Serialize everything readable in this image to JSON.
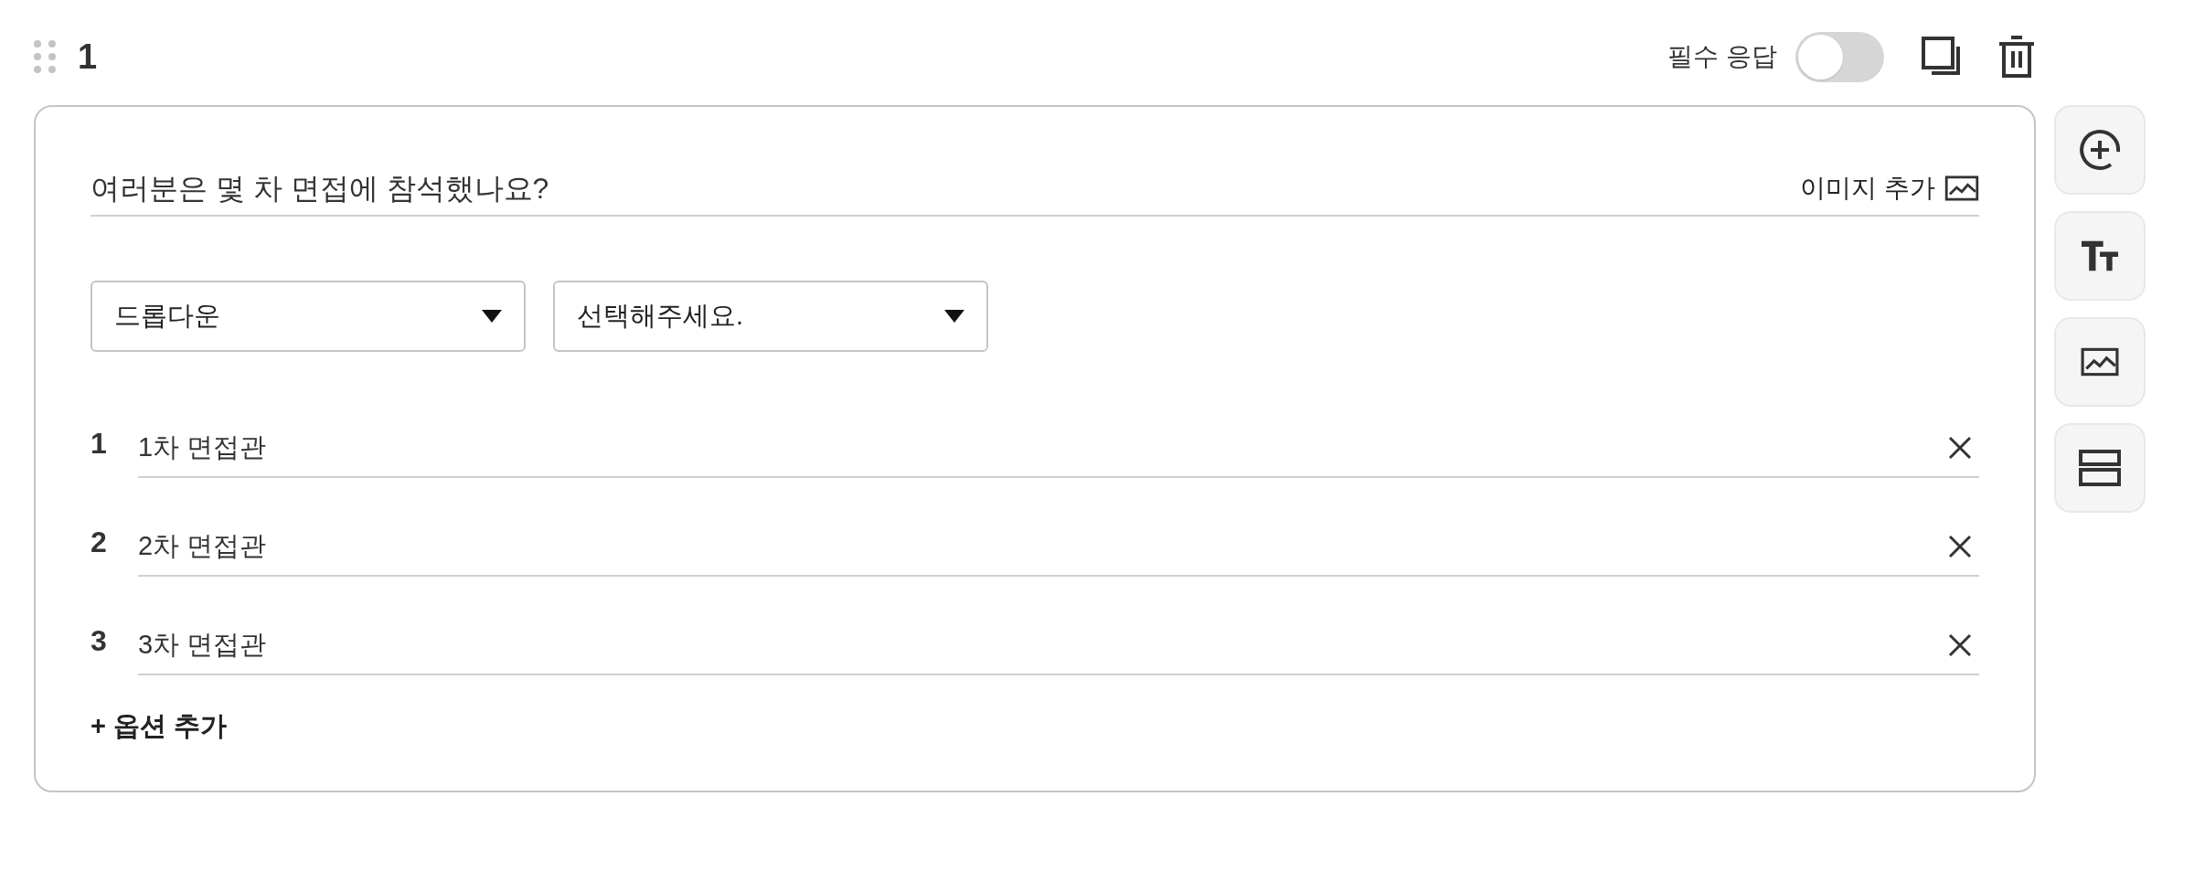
{
  "question_number": "1",
  "required": {
    "label": "필수 응답",
    "on": false
  },
  "question": {
    "value": "여러분은 몇 차 면접에 참석했나요?",
    "image_button": "이미지 추가"
  },
  "selects": [
    {
      "value": "드롭다운"
    },
    {
      "value": "선택해주세요."
    }
  ],
  "options": [
    {
      "number": "1",
      "value": "1차 면접관"
    },
    {
      "number": "2",
      "value": "2차 면접관"
    },
    {
      "number": "3",
      "value": "3차 면접관"
    }
  ],
  "add_option": "+ 옵션 추가"
}
